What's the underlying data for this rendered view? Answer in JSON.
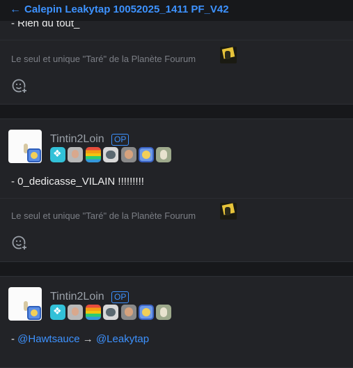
{
  "header": {
    "back_icon": "arrow-left-icon",
    "title": "Calepin Leakytap 10052025_1411 PF_V42"
  },
  "colors": {
    "accent": "#3d92ff",
    "background": "#17181b",
    "card": "#222327",
    "muted": "#7c7f86"
  },
  "posts": [
    {
      "content": "- Rien du tout_",
      "signature": "Le seul et unique \"Taré\" de la Planète Fourum",
      "reaction_icon": "add-reaction-icon"
    },
    {
      "username": "Tintin2Loin",
      "op_label": "OP",
      "content": "- 0_dedicasse_VILAIN !!!!!!!!!",
      "signature": "Le seul et unique \"Taré\" de la Planète Fourum",
      "reaction_icon": "add-reaction-icon"
    },
    {
      "username": "Tintin2Loin",
      "op_label": "OP",
      "content_prefix": "- ",
      "mention_from": "@Hawtsauce",
      "arrow": "→",
      "mention_to": "@Leakytap"
    }
  ]
}
